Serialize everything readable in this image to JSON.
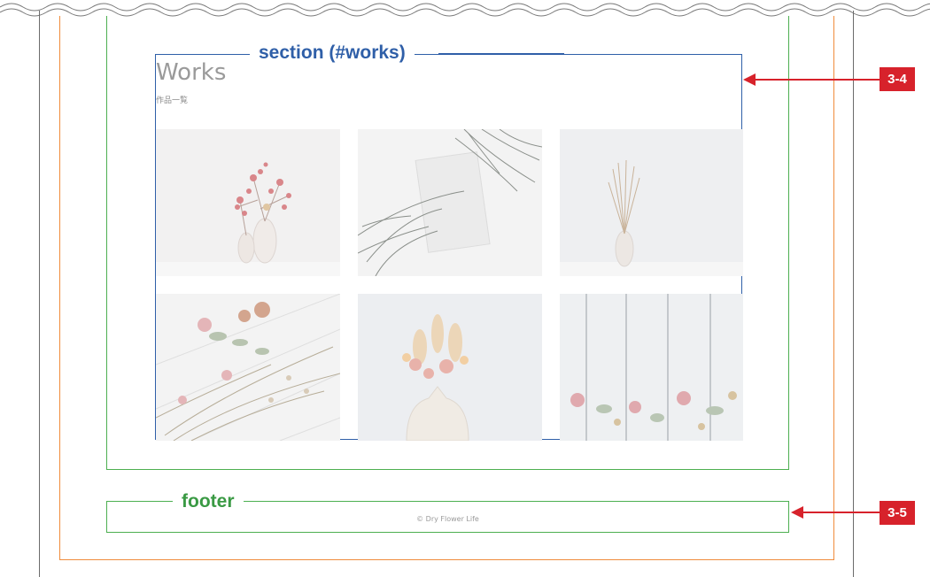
{
  "labels": {
    "section": "section (#works)",
    "footer": "footer"
  },
  "works": {
    "title": "Works",
    "subtitle": "作品一覧",
    "photos": [
      "vases-with-red-flowers",
      "grass-and-marble-frame",
      "vase-with-dried-grass",
      "dried-flowers-on-wood",
      "pampas-bouquet-in-vase",
      "flowers-on-white-planks"
    ]
  },
  "footer": {
    "copyright": "© Dry Flower Life"
  },
  "callouts": {
    "section_badge": "3-4",
    "footer_badge": "3-5"
  },
  "colors": {
    "section_border": "#2f5fa8",
    "container_border": "#4caf50",
    "wrapper_border": "#f08c3c",
    "callout": "#d7222b"
  }
}
